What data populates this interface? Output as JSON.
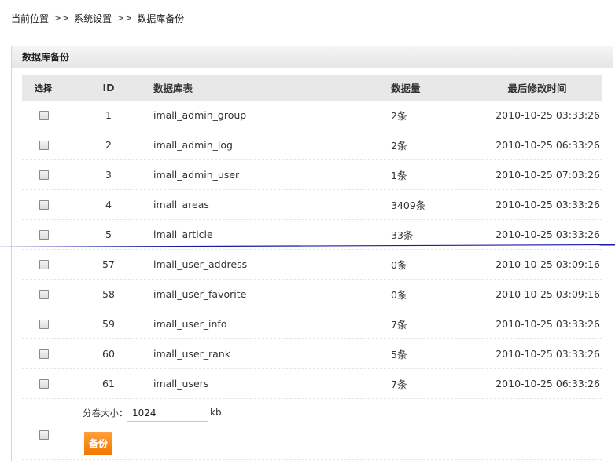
{
  "breadcrumb": {
    "items": [
      "当前位置",
      "系统设置",
      "数据库备份"
    ],
    "separator": ">>"
  },
  "panel": {
    "title": "数据库备份"
  },
  "table": {
    "headers": {
      "select": "选择",
      "id": "ID",
      "name": "数据库表",
      "count": "数据量",
      "time": "最后修改时间"
    },
    "rows": [
      {
        "id": "1",
        "name": "imall_admin_group",
        "count": "2条",
        "time": "2010-10-25 03:33:26"
      },
      {
        "id": "2",
        "name": "imall_admin_log",
        "count": "2条",
        "time": "2010-10-25 06:33:26"
      },
      {
        "id": "3",
        "name": "imall_admin_user",
        "count": "1条",
        "time": "2010-10-25 07:03:26"
      },
      {
        "id": "4",
        "name": "imall_areas",
        "count": "3409条",
        "time": "2010-10-25 03:33:26"
      },
      {
        "id": "5",
        "name": "imall_article",
        "count": "33条",
        "time": "2010-10-25 03:33:26"
      },
      {
        "id": "57",
        "name": "imall_user_address",
        "count": "0条",
        "time": "2010-10-25 03:09:16"
      },
      {
        "id": "58",
        "name": "imall_user_favorite",
        "count": "0条",
        "time": "2010-10-25 03:09:16"
      },
      {
        "id": "59",
        "name": "imall_user_info",
        "count": "7条",
        "time": "2010-10-25 03:33:26"
      },
      {
        "id": "60",
        "name": "imall_user_rank",
        "count": "5条",
        "time": "2010-10-25 03:33:26"
      },
      {
        "id": "61",
        "name": "imall_users",
        "count": "7条",
        "time": "2010-10-25 06:33:26"
      }
    ]
  },
  "footer": {
    "size_label": "分卷大小：",
    "size_value": "1024",
    "size_unit": "kb",
    "backup_label": "备份"
  },
  "colors": {
    "accent": "#f28a1a",
    "divider_line": "#1a1aa8"
  },
  "icons": {
    "checkbox": "checkbox-icon"
  }
}
